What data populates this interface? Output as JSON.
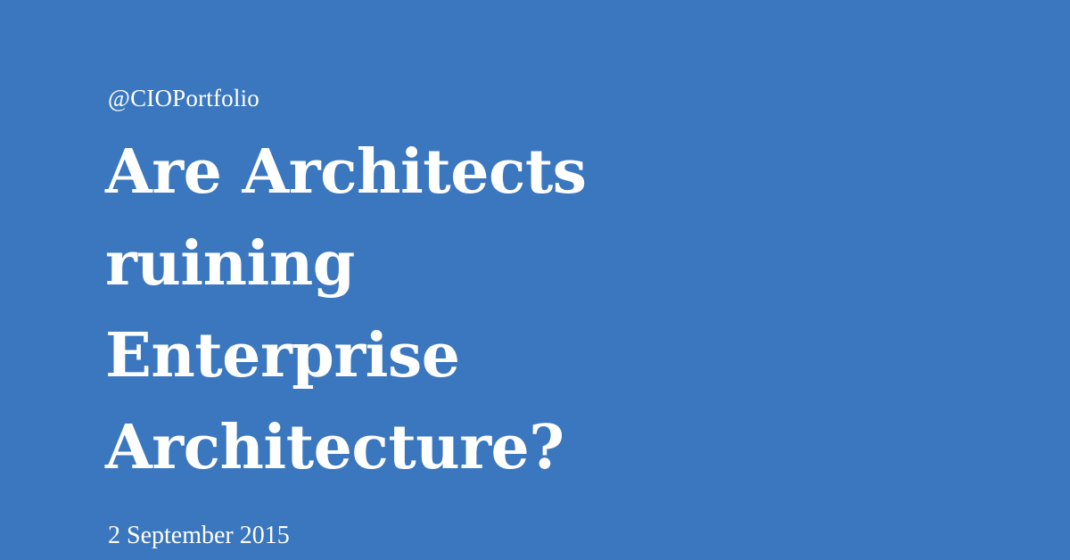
{
  "card": {
    "handle": "@CIOPortfolio",
    "title_lines": [
      "Are Architects",
      "ruining",
      "Enterprise",
      "Architecture?"
    ],
    "date": "2 September 2015"
  },
  "colors": {
    "background": "#3a77bf",
    "text": "#ffffff"
  }
}
